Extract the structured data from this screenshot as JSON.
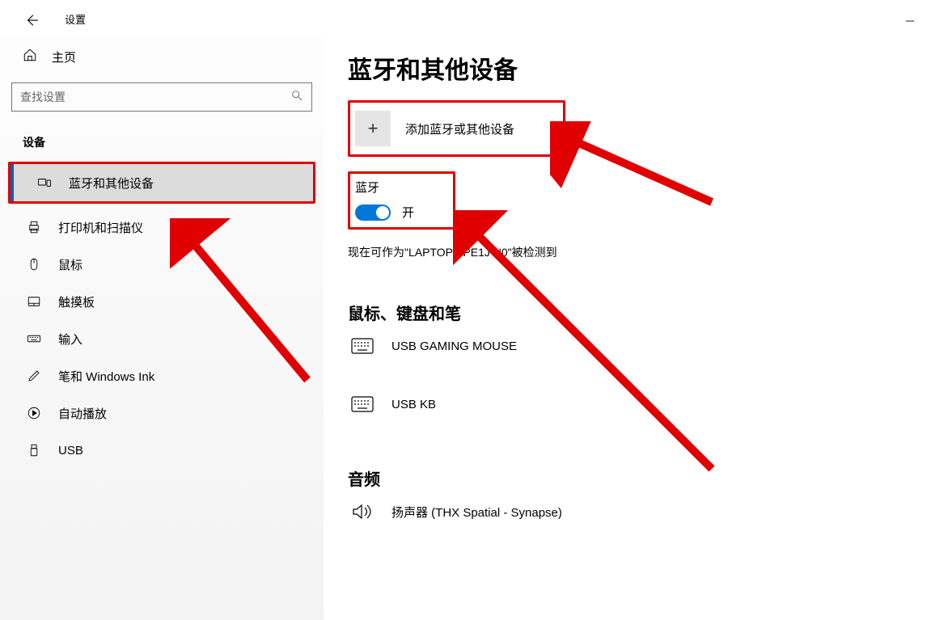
{
  "app": {
    "title": "设置"
  },
  "sidebar": {
    "home": "主页",
    "search_placeholder": "查找设置",
    "section": "设备",
    "items": [
      {
        "label": "蓝牙和其他设备"
      },
      {
        "label": "打印机和扫描仪"
      },
      {
        "label": "鼠标"
      },
      {
        "label": "触摸板"
      },
      {
        "label": "输入"
      },
      {
        "label": "笔和 Windows Ink"
      },
      {
        "label": "自动播放"
      },
      {
        "label": "USB"
      }
    ]
  },
  "main": {
    "heading": "蓝牙和其他设备",
    "add_label": "添加蓝牙或其他设备",
    "bt_heading": "蓝牙",
    "toggle_state": "开",
    "detect_text": "现在可作为\"LAPTOP-8PE1J   N0\"被检测到",
    "group_kbm": "鼠标、键盘和笔",
    "devices_kbm": [
      {
        "label": "USB GAMING MOUSE"
      },
      {
        "label": "USB KB"
      }
    ],
    "group_audio": "音频",
    "devices_audio": [
      {
        "label": "扬声器 (THX Spatial - Synapse)"
      }
    ]
  }
}
